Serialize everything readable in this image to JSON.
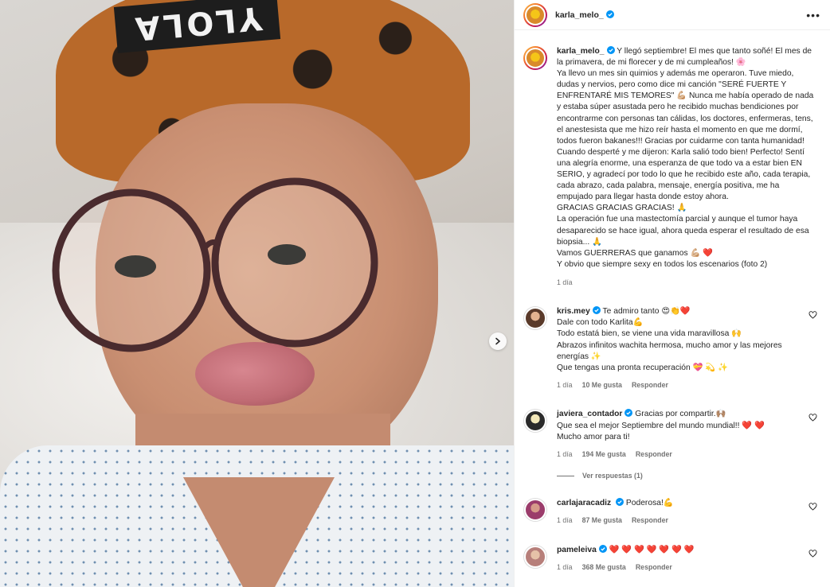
{
  "media": {
    "beanie_text": "YLOLA",
    "next_label": "Siguiente"
  },
  "header": {
    "username": "karla_melo_",
    "more_label": "•••"
  },
  "caption": {
    "username": "karla_melo_",
    "lines": [
      "Y llegó septiembre! El mes que tanto soñé! El mes de la primavera, de mi florecer y de mi cumpleaños! 🌸",
      "Ya llevo un mes sin quimios y además me operaron. Tuve miedo, dudas y nervios, pero como dice mi canción \"SERÉ FUERTE Y ENFRENTARÉ MIS TEMORES\" 💪🏼 Nunca me había operado de nada y estaba súper asustada pero he recibido muchas bendiciones por encontrarme con personas tan cálidas, los doctores, enfermeras, tens, el anestesista que me hizo reír hasta el momento en que me dormí, todos fueron bakanes!!! Gracias por cuidarme con tanta humanidad!",
      "Cuando desperté y me dijeron: Karla salió todo bien! Perfecto! Sentí una alegría enorme, una esperanza de que todo va a estar bien EN SERIO, y agradecí por todo lo que he recibido este año, cada terapia, cada abrazo, cada palabra, mensaje, energía positiva, me ha empujado para llegar hasta donde estoy ahora.",
      "GRACIAS GRACIAS GRACIAS! 🙏",
      "La operación fue una mastectomía parcial y aunque el tumor haya desaparecido se hace igual, ahora queda esperar el resultado de esa biopsia... 🙏",
      "Vamos GUERRERAS que ganamos 💪🏼 ❤️",
      "Y obvio que siempre sexy en todos los escenarios (foto 2)"
    ],
    "time": "1 día"
  },
  "comments": [
    {
      "username": "kris.mey",
      "text": "Te admiro tanto 😍👏❤️\nDale con todo Karlita💪\nTodo estatá bien, se viene una vida maravillosa 🙌\nAbrazos infinitos wachita hermosa, mucho amor y las mejores energías ✨\nQue tengas una pronta recuperación 💝 💫 ✨",
      "time": "1 día",
      "likes": "10 Me gusta",
      "reply": "Responder"
    },
    {
      "username": "javiera_contador",
      "text": "Gracias por compartir.🙌🏽\nQue sea el mejor Septiembre del mundo mundial!! ❤️ ❤️\nMucho amor para ti!",
      "time": "1 día",
      "likes": "194 Me gusta",
      "reply": "Responder",
      "replies": "Ver respuestas (1)"
    },
    {
      "username": "carlajaracadiz",
      "text": "Poderosa!💪",
      "time": "1 día",
      "likes": "87 Me gusta",
      "reply": "Responder"
    },
    {
      "username": "pameleiva",
      "text": "❤️ ❤️ ❤️ ❤️ ❤️ ❤️ ❤️",
      "time": "1 día",
      "likes": "368 Me gusta",
      "reply": "Responder"
    }
  ],
  "colors": {
    "verified": "#0095f6",
    "meta": "#737373",
    "text": "#262626"
  }
}
